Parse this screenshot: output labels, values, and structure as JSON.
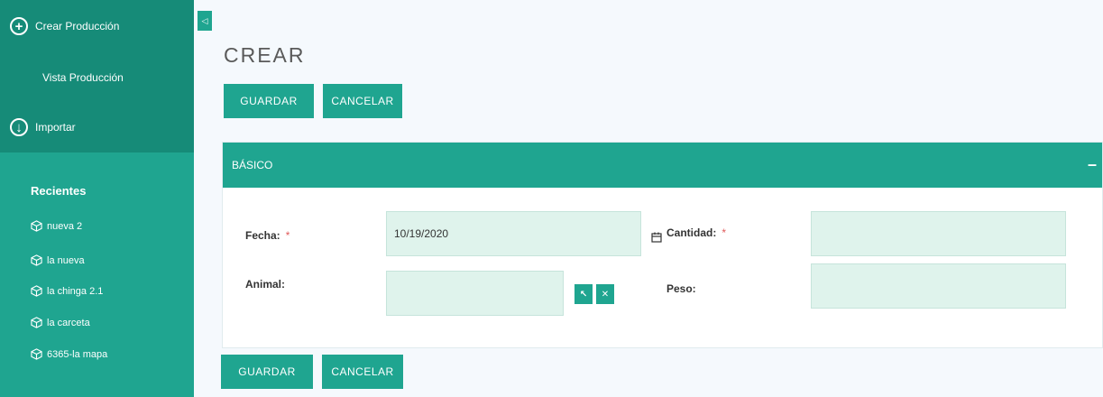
{
  "sidebar": {
    "create_label": "Crear Producción",
    "view_label": "Vista Producción",
    "import_label": "Importar",
    "recents_title": "Recientes",
    "recents": [
      {
        "label": "nueva 2"
      },
      {
        "label": "la nueva"
      },
      {
        "label": "la chinga 2.1"
      },
      {
        "label": "la carceta"
      },
      {
        "label": "6365-la mapa"
      }
    ]
  },
  "collapse_glyph": "◁",
  "page": {
    "title": "CREAR",
    "save_label": "GUARDAR",
    "cancel_label": "CANCELAR"
  },
  "panel": {
    "title": "BÁSICO",
    "collapse_glyph": "–",
    "fields": {
      "fecha": {
        "label": "Fecha:",
        "value": "10/19/2020",
        "required": "*"
      },
      "cantidad": {
        "label": "Cantidad:",
        "value": "",
        "required": "*"
      },
      "animal": {
        "label": "Animal:",
        "value": ""
      },
      "peso": {
        "label": "Peso:",
        "value": ""
      }
    },
    "select_glyph": "↖",
    "clear_glyph": "✕"
  },
  "colors": {
    "primary": "#1fa590",
    "primary_dark": "#168b78",
    "input_bg": "#dff3ec",
    "page_bg": "#f5f9fd",
    "required": "#e05a5a"
  }
}
